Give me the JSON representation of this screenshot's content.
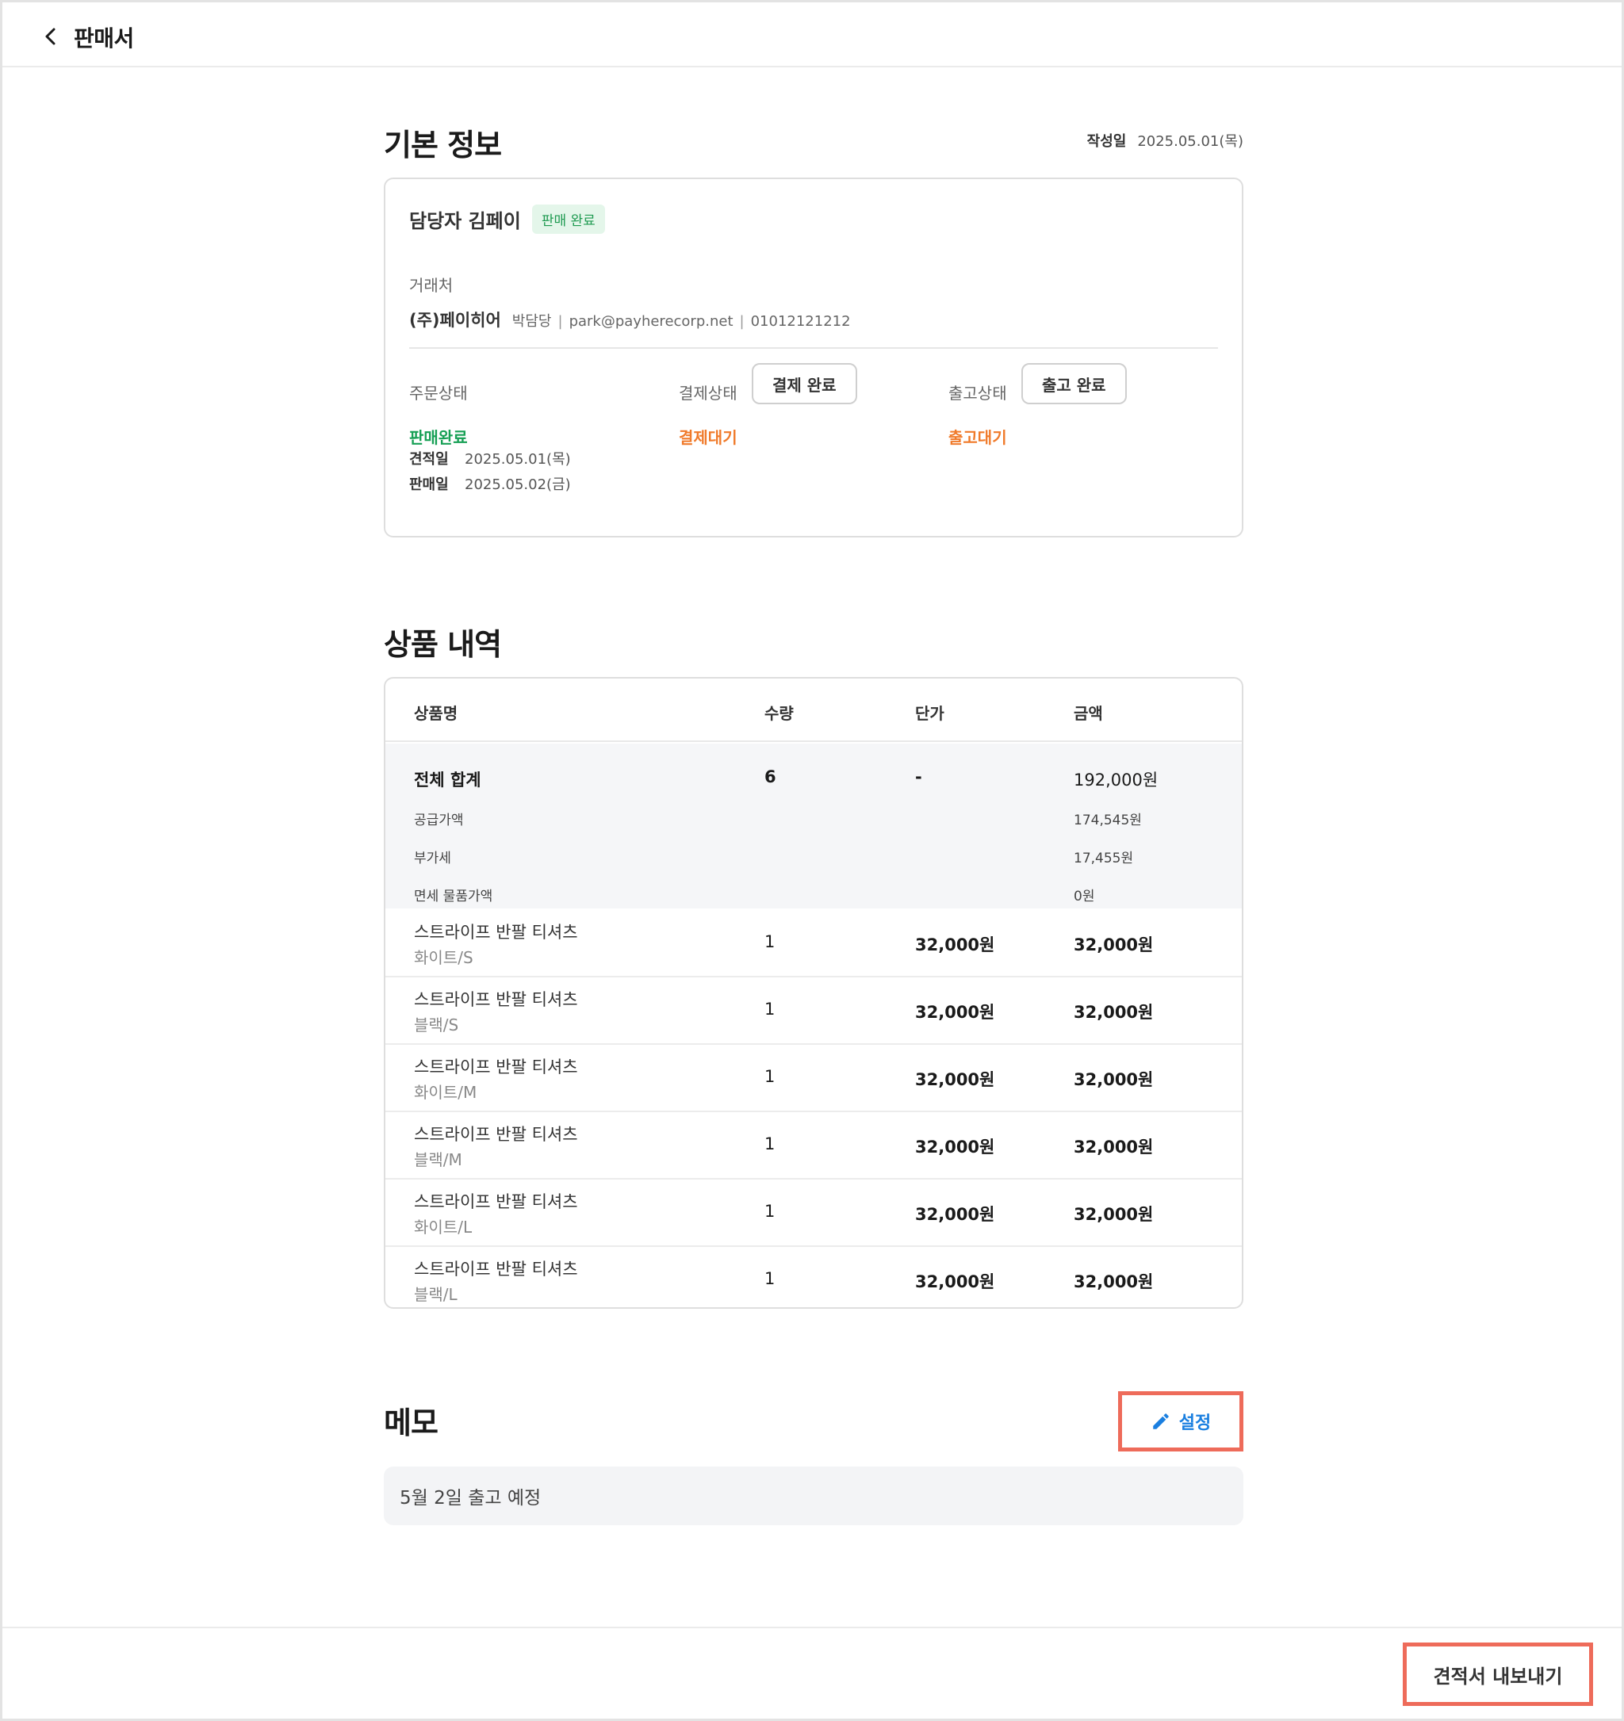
{
  "header": {
    "title": "판매서"
  },
  "basic_info": {
    "section_title": "기본 정보",
    "created_label": "작성일",
    "created_date": "2025.05.01(목)",
    "manager": "담당자 김페이",
    "sale_badge": "판매 완료",
    "client_label": "거래처",
    "client_name": "(주)페이히어",
    "client_contact": "박담당",
    "client_email": "park@payherecorp.net",
    "client_phone": "01012121212",
    "order_status_label": "주문상태",
    "order_status_value": "판매완료",
    "payment_status_label": "결제상태",
    "payment_button": "결제 완료",
    "payment_status_value": "결제대기",
    "shipping_status_label": "출고상태",
    "shipping_button": "출고 완료",
    "shipping_status_value": "출고대기",
    "estimate_date_label": "견적일",
    "estimate_date": "2025.05.01(목)",
    "sale_date_label": "판매일",
    "sale_date": "2025.05.02(금)"
  },
  "products": {
    "section_title": "상품 내역",
    "columns": [
      "상품명",
      "수량",
      "단가",
      "금액"
    ],
    "total": {
      "label": "전체 합계",
      "qty": "6",
      "unit": "-",
      "amount": "192,000원"
    },
    "breakdown": [
      {
        "label": "공급가액",
        "amount": "174,545원"
      },
      {
        "label": "부가세",
        "amount": "17,455원"
      },
      {
        "label": "면세 물품가액",
        "amount": "0원"
      }
    ],
    "rows": [
      {
        "name": "스트라이프 반팔 티셔츠",
        "option": "화이트/S",
        "qty": "1",
        "unit": "32,000원",
        "amount": "32,000원"
      },
      {
        "name": "스트라이프 반팔 티셔츠",
        "option": "블랙/S",
        "qty": "1",
        "unit": "32,000원",
        "amount": "32,000원"
      },
      {
        "name": "스트라이프 반팔 티셔츠",
        "option": "화이트/M",
        "qty": "1",
        "unit": "32,000원",
        "amount": "32,000원"
      },
      {
        "name": "스트라이프 반팔 티셔츠",
        "option": "블랙/M",
        "qty": "1",
        "unit": "32,000원",
        "amount": "32,000원"
      },
      {
        "name": "스트라이프 반팔 티셔츠",
        "option": "화이트/L",
        "qty": "1",
        "unit": "32,000원",
        "amount": "32,000원"
      },
      {
        "name": "스트라이프 반팔 티셔츠",
        "option": "블랙/L",
        "qty": "1",
        "unit": "32,000원",
        "amount": "32,000원"
      }
    ]
  },
  "memo": {
    "section_title": "메모",
    "edit_button": "설정",
    "content": "5월 2일 출고 예정"
  },
  "footer": {
    "export_button": "견적서 내보내기"
  },
  "colors": {
    "accent_green": "#17a055",
    "accent_orange": "#f07a2a",
    "link_blue": "#1a7fe0",
    "highlight_red": "#ee6b5a"
  },
  "icons": {
    "back": "chevron-left-icon",
    "edit": "pencil-icon"
  }
}
